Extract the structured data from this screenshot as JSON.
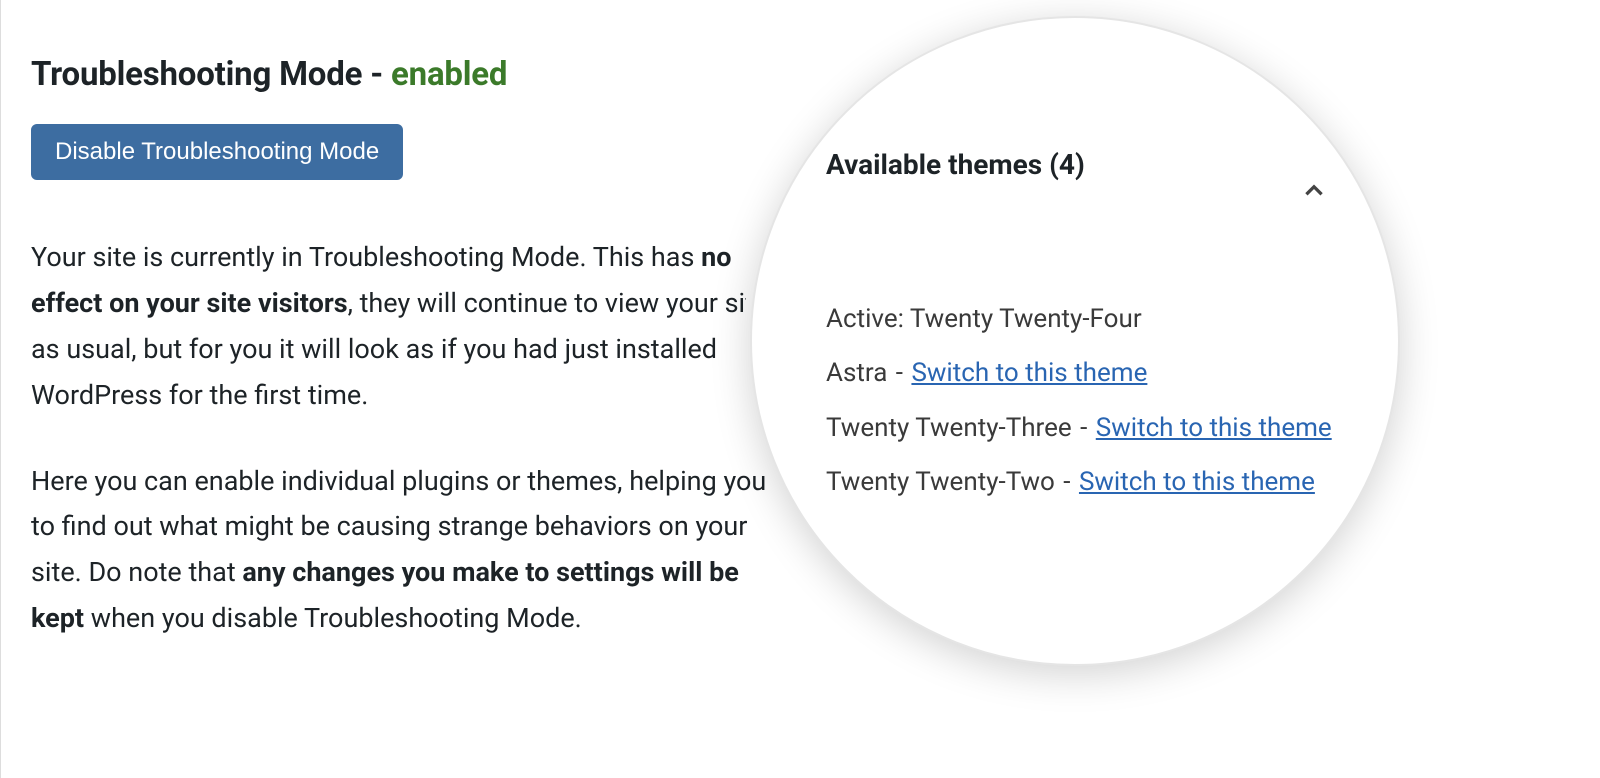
{
  "header": {
    "title_prefix": "Troubleshooting Mode - ",
    "status": "enabled"
  },
  "button": {
    "disable_label": "Disable Troubleshooting Mode"
  },
  "description": {
    "p1_a": "Your site is currently in Troubleshooting Mode. This has ",
    "p1_b": "no effect on your site visitors",
    "p1_c": ", they will continue to view your site as usual, but for you it will look as if you had just installed WordPress for the first time.",
    "p2_a": "Here you can enable individual plugins or themes, helping you to find out what might be causing strange behaviors on your site. Do note that ",
    "p2_b": "any changes you make to settings will be kept",
    "p2_c": " when you disable Troubleshooting Mode."
  },
  "panel": {
    "themes_heading": "Available themes (4)"
  },
  "themes": {
    "active_label": "Active: ",
    "active_name": "Twenty Twenty-Four",
    "switch_label": "Switch to this theme",
    "items": [
      {
        "name": "Astra"
      },
      {
        "name": "Twenty Twenty-Three"
      },
      {
        "name": "Twenty Twenty-Two"
      }
    ]
  }
}
